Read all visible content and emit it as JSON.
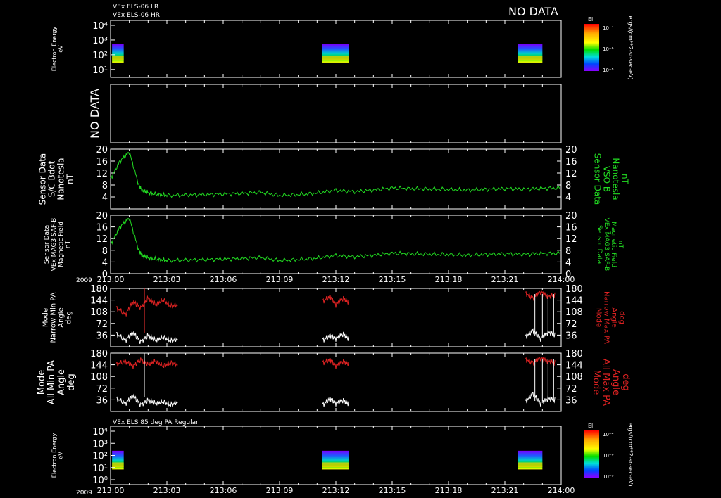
{
  "header": {
    "line1": "VEx ELS-06 LR",
    "line2": "VEx ELS-06 HR",
    "no_data": "NO DATA"
  },
  "year_label": "2009",
  "colors": {
    "background": "#000000",
    "axis": "#ffffff",
    "green": "#22dd22",
    "red": "#dd2222",
    "white": "#ffffff"
  },
  "chart_data": [
    {
      "type": "heatmap",
      "id": "electron-energy-lr-hr",
      "ylabel": [
        "Electron Energy",
        "eV"
      ],
      "y_scale": "log",
      "ylim": [
        1,
        10000
      ],
      "ytick_labels": [
        "10⁴",
        "10³",
        "10²",
        "10¹"
      ],
      "data_blocks_hours": [
        [
          0.08,
          0.7
        ],
        [
          11.25,
          12.7
        ],
        [
          21.7,
          23.0
        ]
      ],
      "colorbar": {
        "label": "El",
        "ticks": [
          "10⁻⁴",
          "10⁻⁶",
          "10⁻⁸"
        ],
        "units": "ergs/(cm**2-sr-sec-eV)"
      }
    },
    {
      "type": "line",
      "id": "no-data-panel",
      "ylabel": [
        "NO DATA"
      ]
    },
    {
      "type": "line",
      "id": "bdot-panel",
      "ylabel": [
        "Sensor Data",
        "S/C Bdot",
        "Nanotesla",
        "nT"
      ],
      "right_label": [
        "Sensor Data",
        "VSO B",
        "Nanotesla",
        "nT"
      ],
      "ylim": [
        0,
        20
      ],
      "yticks": [
        4,
        8,
        12,
        16,
        20
      ],
      "series": [
        {
          "color": "#22dd22",
          "x": [
            0,
            0.5,
            1.0,
            1.5,
            1.7,
            2.0,
            2.5,
            3,
            4,
            5,
            6,
            7,
            8,
            9,
            10,
            11,
            12,
            13,
            14,
            15,
            16,
            17,
            18,
            19,
            20,
            21,
            22,
            23,
            24
          ],
          "y": [
            10,
            16,
            19,
            8,
            6,
            5.5,
            4.8,
            4.5,
            4.6,
            4.8,
            5.0,
            5.2,
            5.5,
            4.5,
            4.8,
            5.3,
            6.2,
            5.8,
            6.3,
            7.0,
            6.8,
            6.7,
            6.5,
            6.3,
            6.6,
            6.8,
            6.6,
            6.9,
            7.0
          ]
        }
      ]
    },
    {
      "type": "line",
      "id": "mag3-panel",
      "ylabel": [
        "Sensor Data",
        "VEx MAG3 SAF-B",
        "Magnetic Field",
        "nT"
      ],
      "right_label": [
        "Sensor Data",
        "VEx MAG3 SAF-B",
        "Magnetic Field",
        "nT"
      ],
      "ylim": [
        0,
        20
      ],
      "yticks": [
        0,
        4,
        8,
        12,
        16,
        20
      ],
      "series": [
        {
          "color": "#22dd22",
          "x": [
            0,
            0.5,
            1.0,
            1.5,
            1.7,
            2.0,
            2.5,
            3,
            4,
            5,
            6,
            7,
            8,
            9,
            10,
            11,
            12,
            13,
            14,
            15,
            16,
            17,
            18,
            19,
            20,
            21,
            22,
            23,
            24
          ],
          "y": [
            10,
            16,
            19,
            8,
            6,
            5.5,
            4.8,
            4.5,
            4.6,
            4.8,
            5.0,
            5.2,
            5.5,
            4.5,
            4.8,
            5.3,
            6.2,
            5.8,
            6.3,
            7.0,
            6.8,
            6.7,
            6.5,
            6.3,
            6.6,
            6.8,
            6.6,
            6.9,
            7.0
          ]
        }
      ],
      "x_tick_labels": [
        "213:00",
        "213:03",
        "213:06",
        "213:09",
        "213:12",
        "213:15",
        "213:18",
        "213:21",
        "214:00"
      ]
    },
    {
      "type": "line",
      "id": "narrow-pa-panel",
      "ylabel": [
        "Mode",
        "Narrow Min PA",
        "Angle",
        "deg"
      ],
      "right_label": [
        "Mode",
        "Narrow Max PA",
        "Angle",
        "deg"
      ],
      "ylim": [
        0,
        180
      ],
      "yticks": [
        36,
        72,
        108,
        144,
        180
      ],
      "series": [
        {
          "name": "Max PA",
          "color": "#dd2222",
          "segments": [
            {
              "x": [
                0.3,
                0.8,
                1.2,
                1.6,
                2.0,
                2.4,
                2.8,
                3.2,
                3.6
              ],
              "y": [
                120,
                100,
                140,
                120,
                150,
                130,
                145,
                125,
                130
              ]
            },
            {
              "x": [
                11.3,
                11.7,
                12.0,
                12.4,
                12.7
              ],
              "y": [
                140,
                155,
                130,
                150,
                135
              ]
            },
            {
              "x": [
                22.1,
                22.5,
                22.9,
                23.3,
                23.7
              ],
              "y": [
                165,
                150,
                170,
                155,
                160
              ]
            }
          ]
        },
        {
          "name": "Min PA",
          "color": "#ffffff",
          "segments": [
            {
              "x": [
                0.3,
                0.8,
                1.2,
                1.6,
                2.0,
                2.4,
                2.8,
                3.2,
                3.6
              ],
              "y": [
                40,
                20,
                45,
                15,
                35,
                20,
                30,
                18,
                25
              ]
            },
            {
              "x": [
                11.3,
                11.7,
                12.0,
                12.4,
                12.7
              ],
              "y": [
                20,
                35,
                25,
                40,
                22
              ]
            },
            {
              "x": [
                22.1,
                22.5,
                22.9,
                23.3,
                23.7
              ],
              "y": [
                30,
                50,
                25,
                45,
                35
              ]
            }
          ]
        }
      ]
    },
    {
      "type": "line",
      "id": "all-pa-panel",
      "ylabel": [
        "Mode",
        "All Min PA",
        "Angle",
        "deg"
      ],
      "right_label": [
        "Mode",
        "All Max PA",
        "Angle",
        "deg"
      ],
      "ylim": [
        0,
        180
      ],
      "yticks": [
        36,
        72,
        108,
        144,
        180
      ],
      "series": [
        {
          "name": "Max PA",
          "color": "#dd2222",
          "segments": [
            {
              "x": [
                0.3,
                0.8,
                1.2,
                1.6,
                2.0,
                2.4,
                2.8,
                3.2,
                3.6
              ],
              "y": [
                145,
                155,
                140,
                160,
                145,
                155,
                140,
                150,
                145
              ]
            },
            {
              "x": [
                11.3,
                11.7,
                12.0,
                12.4,
                12.7
              ],
              "y": [
                150,
                160,
                140,
                155,
                145
              ]
            },
            {
              "x": [
                22.1,
                22.5,
                22.9,
                23.3,
                23.7
              ],
              "y": [
                160,
                150,
                165,
                155,
                150
              ]
            }
          ]
        },
        {
          "name": "Min PA",
          "color": "#ffffff",
          "segments": [
            {
              "x": [
                0.3,
                0.8,
                1.2,
                1.6,
                2.0,
                2.4,
                2.8,
                3.2,
                3.6
              ],
              "y": [
                40,
                25,
                50,
                20,
                35,
                25,
                30,
                20,
                30
              ]
            },
            {
              "x": [
                11.3,
                11.7,
                12.0,
                12.4,
                12.7
              ],
              "y": [
                20,
                40,
                25,
                35,
                22
              ]
            },
            {
              "x": [
                22.1,
                22.5,
                22.9,
                23.3,
                23.7
              ],
              "y": [
                30,
                55,
                25,
                40,
                35
              ]
            }
          ]
        }
      ]
    },
    {
      "type": "heatmap",
      "id": "electron-energy-85deg",
      "title": "VEx ELS 85 deg PA Regular",
      "ylabel": [
        "Electron Energy",
        "eV"
      ],
      "y_scale": "log",
      "ylim": [
        1,
        10000
      ],
      "ytick_labels": [
        "10⁴",
        "10³",
        "10²",
        "10¹",
        "10⁰"
      ],
      "data_blocks_hours": [
        [
          0.08,
          0.7
        ],
        [
          11.25,
          12.7
        ],
        [
          21.7,
          23.0
        ]
      ],
      "colorbar": {
        "label": "El",
        "ticks": [
          "10⁻⁴",
          "10⁻⁶",
          "10⁻⁸"
        ],
        "units": "ergs/(cm**2-sr-sec-eV)"
      },
      "x_tick_labels": [
        "213:00",
        "213:03",
        "213:06",
        "213:09",
        "213:12",
        "213:15",
        "213:18",
        "213:21",
        "214:00"
      ]
    }
  ]
}
